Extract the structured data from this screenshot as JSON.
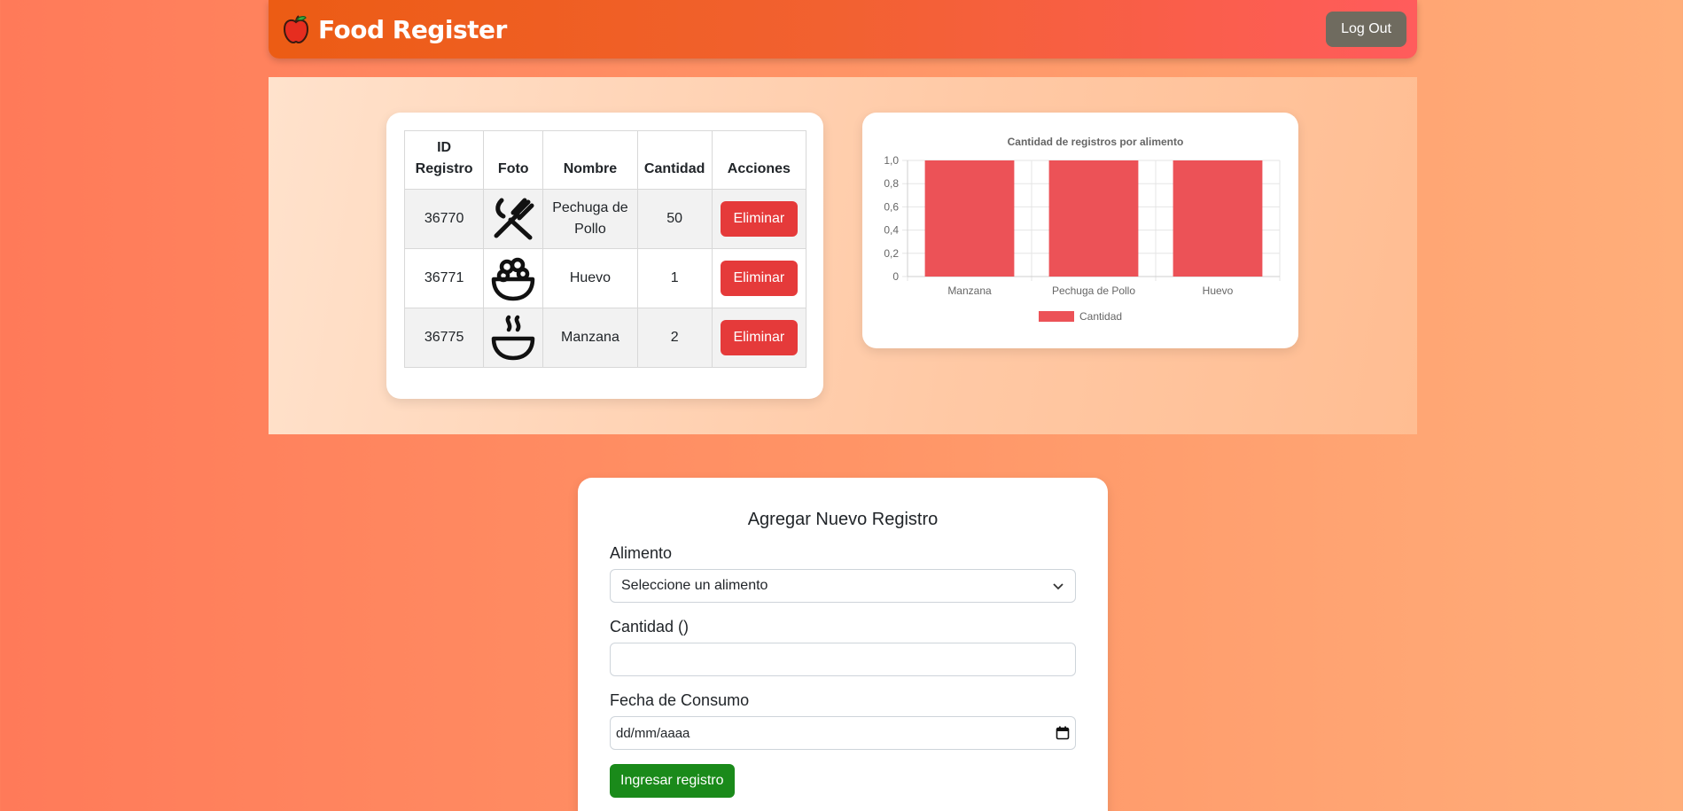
{
  "navbar": {
    "title": "Food Register",
    "logout_label": "Log Out",
    "logo_icon": "apple-icon"
  },
  "table": {
    "headers": [
      "ID Registro",
      "Foto",
      "Nombre",
      "Cantidad",
      "Acciones"
    ],
    "header_id_line1": "ID",
    "header_id_line2": "Registro",
    "rows": [
      {
        "id": "36770",
        "icon": "fork-knife-icon",
        "name_line1": "Pechuga de",
        "name_line2": "Pollo",
        "qty": "50",
        "action": "Eliminar"
      },
      {
        "id": "36771",
        "icon": "salad-bowl-icon",
        "name_line1": "Huevo",
        "name_line2": "",
        "qty": "1",
        "action": "Eliminar"
      },
      {
        "id": "36775",
        "icon": "soup-bowl-icon",
        "name_line1": "Manzana",
        "name_line2": "",
        "qty": "2",
        "action": "Eliminar"
      }
    ]
  },
  "chart_data": {
    "type": "bar",
    "title": "Cantidad de registros por alimento",
    "categories": [
      "Manzana",
      "Pechuga de Pollo",
      "Huevo"
    ],
    "series": [
      {
        "name": "Cantidad",
        "values": [
          1,
          1,
          1
        ],
        "color": "#ec5257"
      }
    ],
    "ylim": [
      0,
      1.0
    ],
    "yticks": [
      "0",
      "0,2",
      "0,4",
      "0,6",
      "0,8",
      "1,0"
    ],
    "grid": true,
    "legend_position": "bottom"
  },
  "form": {
    "title": "Agregar Nuevo Registro",
    "food_label": "Alimento",
    "food_value": "Seleccione un alimento",
    "qty_label": "Cantidad ()",
    "qty_value": "",
    "date_label": "Fecha de Consumo",
    "date_value": "dd/mm/aaaa",
    "submit_label": "Ingresar registro"
  },
  "colors": {
    "accent_orange": "#ec5c14",
    "danger": "#e53a3a",
    "success": "#1a8a1a",
    "bar": "#ec5257"
  }
}
